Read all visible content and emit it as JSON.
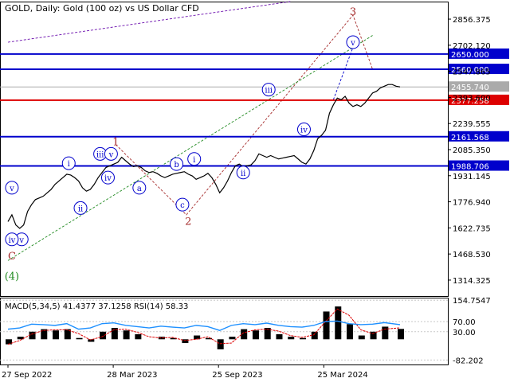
{
  "header": {
    "title": "GOLD, Daily:  Gold (100 oz) vs US Dollar CFD"
  },
  "indicator": {
    "label": "MACD(5,34,5) 41.4377 37.1258 RSI(14) 58.33"
  },
  "colors": {
    "price": "#000000",
    "blue_level": "#0000cc",
    "red_level": "#dd0000",
    "current_price": "#aaaaaa",
    "wave_blue": "#0000cc",
    "wave_red": "#a52a2a",
    "wave_green": "#228b22",
    "channel_green": "#228b22",
    "channel_purple": "#6a0dad",
    "rsi_line": "#1e90ff",
    "macd_signal": "#dd0000",
    "macd_hist": "#000000",
    "grid": "#c8c8c8"
  },
  "chart_data": {
    "type": "line",
    "instrument": "GOLD",
    "timeframe": "Daily",
    "y_ticks": [
      2856.375,
      2702.12,
      2547.865,
      2393.6,
      2239.555,
      2085.35,
      1931.145,
      1776.94,
      1622.735,
      1468.53,
      1314.325
    ],
    "ylim": [
      1220,
      2960
    ],
    "x_ticks": [
      {
        "label": "27 Sep 2022",
        "pos": 0.0
      },
      {
        "label": "28 Mar 2023",
        "pos": 0.2685
      },
      {
        "label": "25 Sep 2023",
        "pos": 0.537
      },
      {
        "label": "25 Mar 2024",
        "pos": 0.8056
      }
    ],
    "price_series": [
      [
        0.0,
        1660
      ],
      [
        0.01,
        1700
      ],
      [
        0.02,
        1640
      ],
      [
        0.03,
        1620
      ],
      [
        0.04,
        1640
      ],
      [
        0.05,
        1720
      ],
      [
        0.06,
        1760
      ],
      [
        0.07,
        1790
      ],
      [
        0.08,
        1800
      ],
      [
        0.09,
        1810
      ],
      [
        0.1,
        1830
      ],
      [
        0.11,
        1850
      ],
      [
        0.12,
        1880
      ],
      [
        0.13,
        1900
      ],
      [
        0.14,
        1920
      ],
      [
        0.15,
        1940
      ],
      [
        0.16,
        1935
      ],
      [
        0.17,
        1920
      ],
      [
        0.18,
        1900
      ],
      [
        0.19,
        1860
      ],
      [
        0.2,
        1840
      ],
      [
        0.21,
        1850
      ],
      [
        0.22,
        1880
      ],
      [
        0.23,
        1920
      ],
      [
        0.24,
        1950
      ],
      [
        0.25,
        1980
      ],
      [
        0.26,
        1990
      ],
      [
        0.27,
        2000
      ],
      [
        0.28,
        2010
      ],
      [
        0.29,
        2040
      ],
      [
        0.3,
        2020
      ],
      [
        0.31,
        2000
      ],
      [
        0.32,
        1985
      ],
      [
        0.33,
        1990
      ],
      [
        0.34,
        1980
      ],
      [
        0.35,
        1960
      ],
      [
        0.36,
        1950
      ],
      [
        0.37,
        1955
      ],
      [
        0.38,
        1945
      ],
      [
        0.39,
        1930
      ],
      [
        0.4,
        1920
      ],
      [
        0.41,
        1930
      ],
      [
        0.42,
        1940
      ],
      [
        0.43,
        1945
      ],
      [
        0.44,
        1950
      ],
      [
        0.45,
        1955
      ],
      [
        0.46,
        1940
      ],
      [
        0.47,
        1930
      ],
      [
        0.48,
        1910
      ],
      [
        0.49,
        1920
      ],
      [
        0.5,
        1930
      ],
      [
        0.51,
        1945
      ],
      [
        0.52,
        1920
      ],
      [
        0.53,
        1880
      ],
      [
        0.54,
        1830
      ],
      [
        0.55,
        1860
      ],
      [
        0.56,
        1900
      ],
      [
        0.57,
        1950
      ],
      [
        0.58,
        1990
      ],
      [
        0.59,
        2000
      ],
      [
        0.6,
        1985
      ],
      [
        0.61,
        1990
      ],
      [
        0.62,
        1995
      ],
      [
        0.63,
        2020
      ],
      [
        0.64,
        2060
      ],
      [
        0.65,
        2050
      ],
      [
        0.66,
        2040
      ],
      [
        0.67,
        2050
      ],
      [
        0.68,
        2040
      ],
      [
        0.69,
        2030
      ],
      [
        0.7,
        2035
      ],
      [
        0.71,
        2040
      ],
      [
        0.72,
        2045
      ],
      [
        0.73,
        2050
      ],
      [
        0.74,
        2030
      ],
      [
        0.75,
        2010
      ],
      [
        0.76,
        2000
      ],
      [
        0.77,
        2030
      ],
      [
        0.78,
        2080
      ],
      [
        0.79,
        2150
      ],
      [
        0.8,
        2170
      ],
      [
        0.81,
        2200
      ],
      [
        0.82,
        2300
      ],
      [
        0.83,
        2350
      ],
      [
        0.84,
        2390
      ],
      [
        0.85,
        2380
      ],
      [
        0.86,
        2400
      ],
      [
        0.87,
        2360
      ],
      [
        0.88,
        2340
      ],
      [
        0.89,
        2350
      ],
      [
        0.9,
        2340
      ],
      [
        0.91,
        2360
      ],
      [
        0.92,
        2390
      ],
      [
        0.93,
        2420
      ],
      [
        0.94,
        2430
      ],
      [
        0.95,
        2450
      ],
      [
        0.96,
        2460
      ],
      [
        0.97,
        2470
      ],
      [
        0.98,
        2470
      ],
      [
        0.99,
        2460
      ],
      [
        1.0,
        2456
      ]
    ],
    "horizontal_levels": [
      {
        "value": 2650.0,
        "label": "2650.000",
        "style": "blue"
      },
      {
        "value": 2560.0,
        "label": "2560.000",
        "style": "blue"
      },
      {
        "value": 2377.258,
        "label": "2377.258",
        "style": "red"
      },
      {
        "value": 2161.568,
        "label": "2161.568",
        "style": "blue"
      },
      {
        "value": 1988.706,
        "label": "1988.706",
        "style": "blue"
      }
    ],
    "current_price": {
      "value": 2455.74,
      "label": "2455.740"
    },
    "wave_labels": [
      {
        "text": "3",
        "color": "red",
        "circled": false,
        "pos": 0.88,
        "value": 2900
      },
      {
        "text": "1",
        "color": "red",
        "circled": false,
        "pos": 0.275,
        "value": 2130
      },
      {
        "text": "2",
        "color": "red",
        "circled": false,
        "pos": 0.46,
        "value": 1660
      },
      {
        "text": "C",
        "color": "red",
        "circled": false,
        "pos": 0.01,
        "value": 1455
      },
      {
        "text": "(4)",
        "color": "green",
        "circled": false,
        "pos": 0.01,
        "value": 1335
      },
      {
        "text": "v",
        "color": "blue",
        "circled": true,
        "pos": 0.88,
        "value": 2720
      },
      {
        "text": "iii",
        "color": "blue",
        "circled": true,
        "pos": 0.665,
        "value": 2440
      },
      {
        "text": "iv",
        "color": "blue",
        "circled": true,
        "pos": 0.755,
        "value": 2205
      },
      {
        "text": "ii",
        "color": "blue",
        "circled": true,
        "pos": 0.6,
        "value": 1950
      },
      {
        "text": "i",
        "color": "blue",
        "circled": true,
        "pos": 0.475,
        "value": 2030
      },
      {
        "text": "b",
        "color": "blue",
        "circled": true,
        "pos": 0.43,
        "value": 2000
      },
      {
        "text": "c",
        "color": "blue",
        "circled": true,
        "pos": 0.445,
        "value": 1760
      },
      {
        "text": "a",
        "color": "blue",
        "circled": true,
        "pos": 0.335,
        "value": 1860
      },
      {
        "text": "iii",
        "color": "blue",
        "circled": true,
        "pos": 0.235,
        "value": 2060
      },
      {
        "text": "v",
        "color": "blue",
        "circled": true,
        "pos": 0.263,
        "value": 2060
      },
      {
        "text": "iv",
        "color": "blue",
        "circled": true,
        "pos": 0.255,
        "value": 1920
      },
      {
        "text": "i",
        "color": "blue",
        "circled": true,
        "pos": 0.155,
        "value": 2005
      },
      {
        "text": "ii",
        "color": "blue",
        "circled": true,
        "pos": 0.185,
        "value": 1740
      },
      {
        "text": "v",
        "color": "blue",
        "circled": true,
        "pos": 0.01,
        "value": 1860
      },
      {
        "text": "v",
        "color": "blue",
        "circled": true,
        "pos": 0.035,
        "value": 1555
      },
      {
        "text": "iv",
        "color": "blue",
        "circled": true,
        "pos": 0.01,
        "value": 1555
      }
    ],
    "dashed_paths": [
      {
        "color": "red",
        "points": [
          [
            0.275,
            2115
          ],
          [
            0.455,
            1700
          ],
          [
            0.88,
            2880
          ],
          [
            0.93,
            2560
          ]
        ]
      },
      {
        "color": "green",
        "points": [
          [
            0.0,
            1430
          ],
          [
            0.93,
            2760
          ]
        ]
      },
      {
        "color": "purple",
        "points": [
          [
            0.0,
            2720
          ],
          [
            0.72,
            2960
          ]
        ]
      },
      {
        "color": "blue",
        "points": [
          [
            0.83,
            2380
          ],
          [
            0.88,
            2690
          ]
        ]
      }
    ],
    "macd": {
      "y_ticks": [
        154.7547,
        70.0,
        30.0,
        -82.202
      ],
      "ylim": [
        -100,
        165
      ],
      "rsi_series": [
        [
          0.0,
          40
        ],
        [
          0.03,
          45
        ],
        [
          0.06,
          60
        ],
        [
          0.09,
          58
        ],
        [
          0.12,
          55
        ],
        [
          0.15,
          62
        ],
        [
          0.18,
          40
        ],
        [
          0.21,
          45
        ],
        [
          0.24,
          62
        ],
        [
          0.27,
          65
        ],
        [
          0.3,
          55
        ],
        [
          0.33,
          50
        ],
        [
          0.36,
          45
        ],
        [
          0.39,
          52
        ],
        [
          0.42,
          48
        ],
        [
          0.45,
          45
        ],
        [
          0.48,
          55
        ],
        [
          0.51,
          50
        ],
        [
          0.54,
          35
        ],
        [
          0.57,
          55
        ],
        [
          0.6,
          62
        ],
        [
          0.63,
          58
        ],
        [
          0.66,
          64
        ],
        [
          0.69,
          55
        ],
        [
          0.72,
          50
        ],
        [
          0.75,
          48
        ],
        [
          0.78,
          55
        ],
        [
          0.81,
          70
        ],
        [
          0.84,
          72
        ],
        [
          0.87,
          62
        ],
        [
          0.9,
          58
        ],
        [
          0.93,
          60
        ],
        [
          0.96,
          66
        ],
        [
          1.0,
          58
        ]
      ],
      "macd_hist": [
        [
          0.0,
          -20
        ],
        [
          0.03,
          10
        ],
        [
          0.06,
          30
        ],
        [
          0.09,
          40
        ],
        [
          0.12,
          35
        ],
        [
          0.15,
          40
        ],
        [
          0.18,
          5
        ],
        [
          0.21,
          -10
        ],
        [
          0.24,
          30
        ],
        [
          0.27,
          45
        ],
        [
          0.3,
          35
        ],
        [
          0.33,
          20
        ],
        [
          0.36,
          0
        ],
        [
          0.39,
          10
        ],
        [
          0.42,
          5
        ],
        [
          0.45,
          -15
        ],
        [
          0.48,
          15
        ],
        [
          0.51,
          5
        ],
        [
          0.54,
          -40
        ],
        [
          0.57,
          10
        ],
        [
          0.6,
          40
        ],
        [
          0.63,
          35
        ],
        [
          0.66,
          45
        ],
        [
          0.69,
          20
        ],
        [
          0.72,
          10
        ],
        [
          0.75,
          5
        ],
        [
          0.78,
          30
        ],
        [
          0.81,
          110
        ],
        [
          0.84,
          130
        ],
        [
          0.87,
          60
        ],
        [
          0.9,
          15
        ],
        [
          0.93,
          30
        ],
        [
          0.96,
          50
        ],
        [
          1.0,
          41
        ]
      ]
    }
  }
}
